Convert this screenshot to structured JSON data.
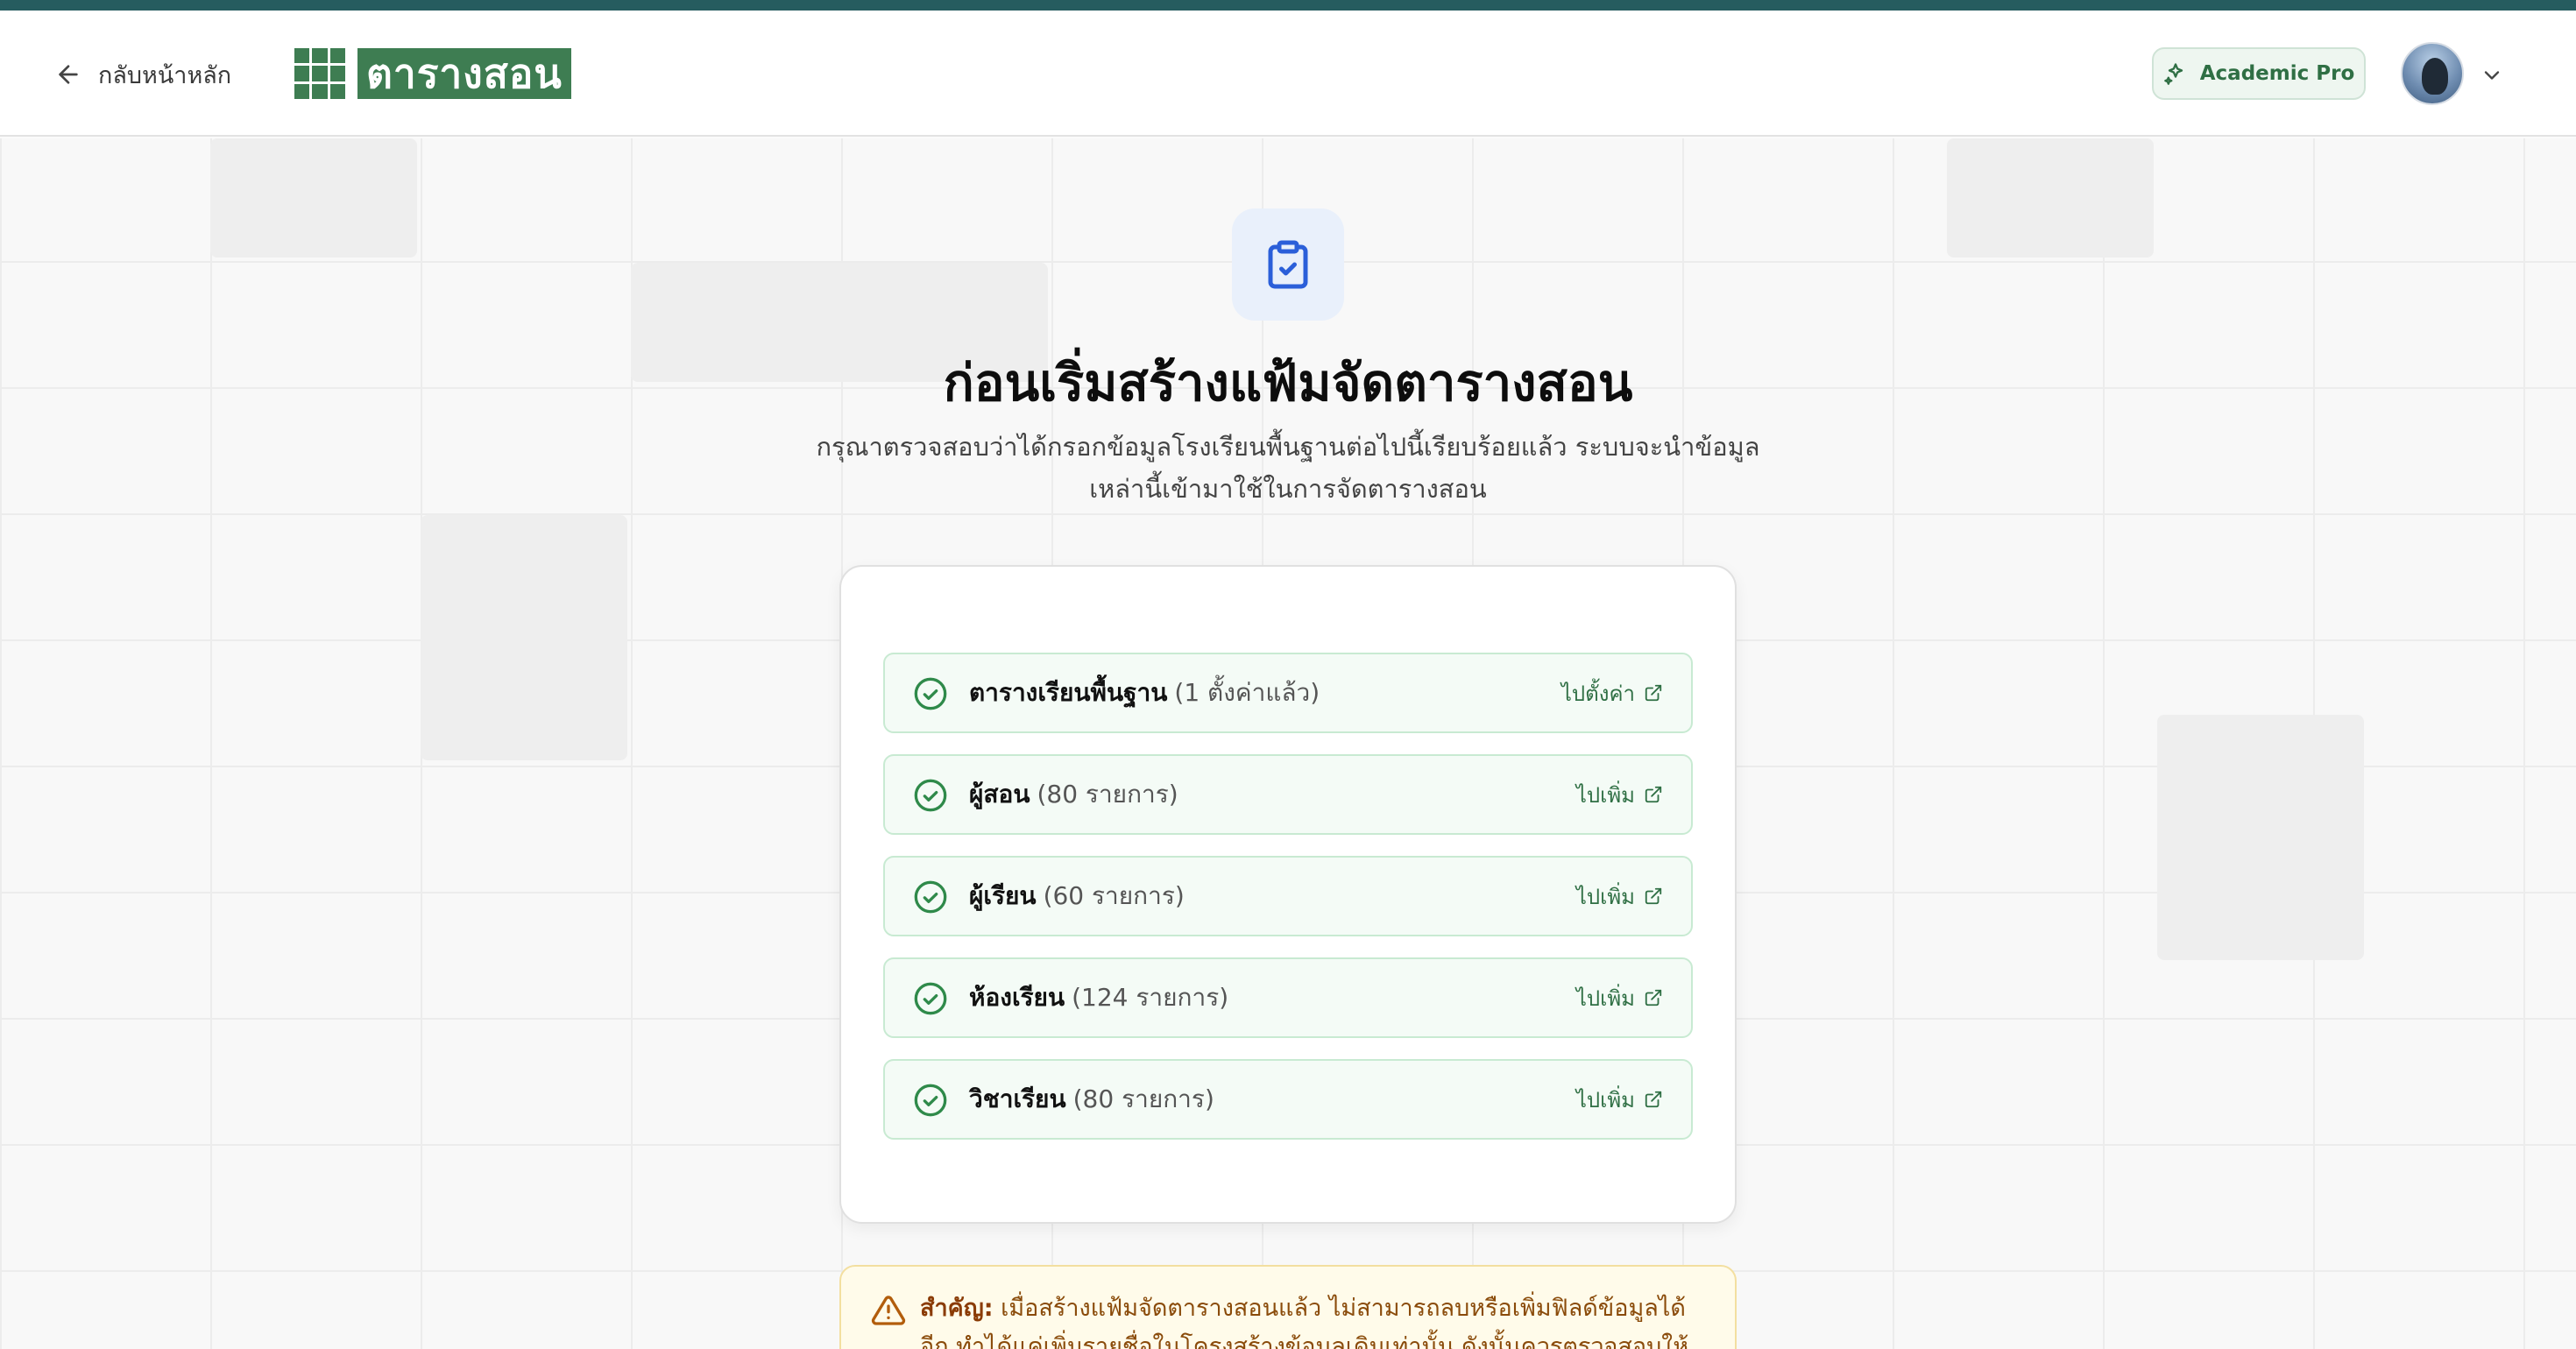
{
  "header": {
    "back_label": "กลับหน้าหลัก",
    "logo_text": "ตารางสอน",
    "plan_label": "Academic Pro"
  },
  "hero": {
    "title": "ก่อนเริ่มสร้างแฟ้มจัดตารางสอน",
    "subtitle": "กรุณาตรวจสอบว่าได้กรอกข้อมูลโรงเรียนพื้นฐานต่อไปนี้เรียบร้อยแล้ว ระบบจะนำข้อมูลเหล่านี้เข้ามาใช้ในการจัดตารางสอน"
  },
  "checklist": [
    {
      "label": "ตารางเรียนพื้นฐาน",
      "count": "(1 ตั้งค่าแล้ว)",
      "action": "ไปตั้งค่า",
      "status": "complete"
    },
    {
      "label": "ผู้สอน",
      "count": "(80 รายการ)",
      "action": "ไปเพิ่ม",
      "status": "complete"
    },
    {
      "label": "ผู้เรียน",
      "count": "(60 รายการ)",
      "action": "ไปเพิ่ม",
      "status": "complete"
    },
    {
      "label": "ห้องเรียน",
      "count": "(124 รายการ)",
      "action": "ไปเพิ่ม",
      "status": "complete"
    },
    {
      "label": "วิชาเรียน",
      "count": "(80 รายการ)",
      "action": "ไปเพิ่ม",
      "status": "complete"
    }
  ],
  "warning": {
    "title": "สำคัญ:",
    "text": "เมื่อสร้างแฟ้มจัดตารางสอนแล้ว ไม่สามารถลบหรือเพิ่มฟิลด์ข้อมูลได้อีก ทำได้แค่เพิ่มรายชื่อในโครงสร้างข้อมูลเดิมเท่านั้น ดังนั้นควรตรวจสอบให้ครบถ้วน"
  },
  "icons": {
    "back": "arrow-left-icon",
    "logo": "grid-logo-icon",
    "plan": "sparkles-icon",
    "avatar_menu": "chevron-down-icon",
    "hero": "clipboard-check-icon",
    "row_status": "check-circle-icon",
    "row_action": "external-link-icon",
    "warning": "warning-triangle-icon"
  },
  "colors": {
    "top_strip": "#265c5f",
    "brand_green": "#3e7d52",
    "success_green": "#2f8a4a",
    "hero_icon_blue": "#2b5fd9",
    "warning_text": "#8a4b0a"
  }
}
